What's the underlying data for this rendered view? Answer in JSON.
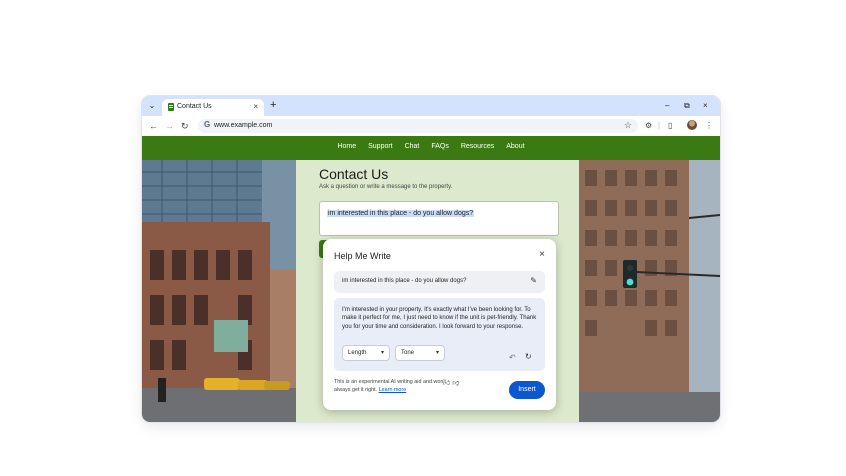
{
  "browser": {
    "tab_title": "Contact Us",
    "tab_list_icon": "chevron-down-icon",
    "new_tab_symbol": "+",
    "tab_close_symbol": "×",
    "url": "www.example.com",
    "window_controls": [
      "–",
      "⧉",
      "×"
    ]
  },
  "site": {
    "nav": [
      "Home",
      "Support",
      "Chat",
      "FAQs",
      "Resources",
      "About"
    ],
    "brand_color": "#3b7a12",
    "background_color": "#dde9cc"
  },
  "contact": {
    "title": "Contact Us",
    "subtitle": "Ask a question or write a message to the property.",
    "message": "im interested in this place - do you allow dogs?"
  },
  "help_me_write": {
    "title": "Help Me Write",
    "prompt": "im interested in this place - do you allow dogs?",
    "result": "I'm interested in your property. It's exactly what I've been looking for. To make it perfect for me, I just need to know if the unit is pet-friendly. Thank you for your time and consideration. I look forward to your response.",
    "length_label": "Length",
    "tone_label": "Tone",
    "disclaimer": "This is an experimental AI writing aid and won't always get it right.",
    "learn_more": "Learn more",
    "insert_label": "Insert",
    "accent_color": "#0b57d0"
  }
}
